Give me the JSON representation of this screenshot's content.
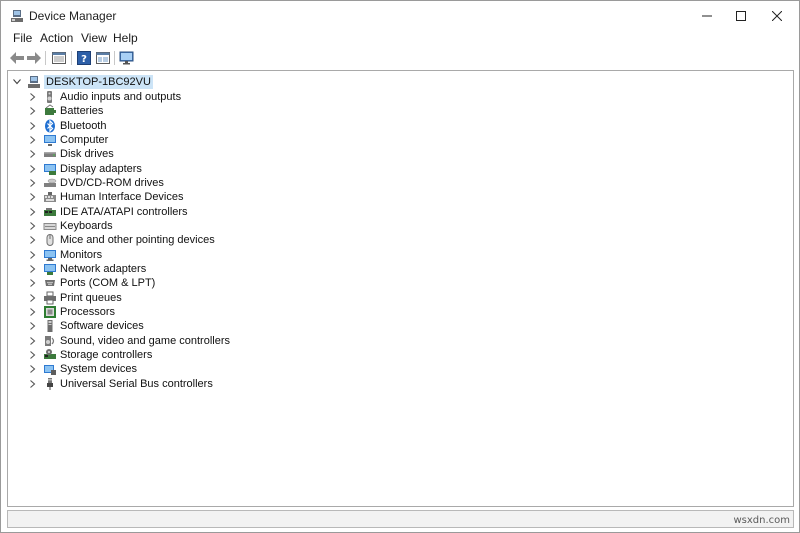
{
  "window": {
    "title": "Device Manager"
  },
  "menu": [
    {
      "label": "File"
    },
    {
      "label": "Action"
    },
    {
      "label": "View"
    },
    {
      "label": "Help"
    }
  ],
  "toolbar": {
    "buttons": [
      {
        "icon": "back-arrow-icon"
      },
      {
        "icon": "forward-arrow-icon"
      },
      {
        "icon": "properties-icon"
      },
      {
        "icon": "help-icon"
      },
      {
        "icon": "view-icon"
      },
      {
        "icon": "monitor-scan-icon"
      }
    ]
  },
  "tree": {
    "root": {
      "label": "DESKTOP-1BC92VU"
    },
    "categories": [
      {
        "label": "Audio inputs and outputs",
        "icon": "speaker-icon"
      },
      {
        "label": "Batteries",
        "icon": "battery-icon"
      },
      {
        "label": "Bluetooth",
        "icon": "bluetooth-icon"
      },
      {
        "label": "Computer",
        "icon": "computer-icon"
      },
      {
        "label": "Disk drives",
        "icon": "disk-drive-icon"
      },
      {
        "label": "Display adapters",
        "icon": "display-adapter-icon"
      },
      {
        "label": "DVD/CD-ROM drives",
        "icon": "dvd-drive-icon"
      },
      {
        "label": "Human Interface Devices",
        "icon": "hid-icon"
      },
      {
        "label": "IDE ATA/ATAPI controllers",
        "icon": "ide-controller-icon"
      },
      {
        "label": "Keyboards",
        "icon": "keyboard-icon"
      },
      {
        "label": "Mice and other pointing devices",
        "icon": "mouse-icon"
      },
      {
        "label": "Monitors",
        "icon": "monitor-icon"
      },
      {
        "label": "Network adapters",
        "icon": "network-adapter-icon"
      },
      {
        "label": "Ports (COM & LPT)",
        "icon": "port-icon"
      },
      {
        "label": "Print queues",
        "icon": "printer-icon"
      },
      {
        "label": "Processors",
        "icon": "processor-icon"
      },
      {
        "label": "Software devices",
        "icon": "software-device-icon"
      },
      {
        "label": "Sound, video and game controllers",
        "icon": "sound-controller-icon"
      },
      {
        "label": "Storage controllers",
        "icon": "storage-controller-icon"
      },
      {
        "label": "System devices",
        "icon": "system-device-icon"
      },
      {
        "label": "Universal Serial Bus controllers",
        "icon": "usb-icon"
      }
    ]
  },
  "watermark": "wsxdn.com"
}
